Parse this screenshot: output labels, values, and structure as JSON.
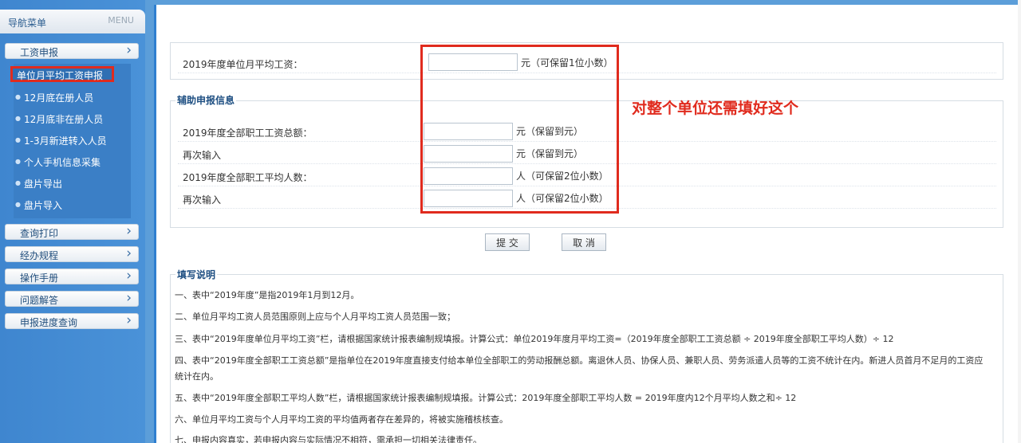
{
  "nav": {
    "title": "导航菜单",
    "menu_label": "MENU",
    "sections": [
      {
        "label": "工资申报"
      },
      {
        "label": "查询打印"
      },
      {
        "label": "经办规程"
      },
      {
        "label": "操作手册"
      },
      {
        "label": "问题解答"
      },
      {
        "label": "申报进度查询"
      }
    ],
    "sub_items": [
      {
        "label": "单位月平均工资申报"
      },
      {
        "label": "12月底在册人员"
      },
      {
        "label": "12月底非在册人员"
      },
      {
        "label": "1-3月新进转入人员"
      },
      {
        "label": "个人手机信息采集"
      },
      {
        "label": "盘片导出"
      },
      {
        "label": "盘片导入"
      }
    ]
  },
  "form": {
    "avg_wage_label": "2019年度单位月平均工资：",
    "avg_wage_value": "",
    "avg_wage_unit": "元（可保留1位小数）",
    "aux_title": "辅助申报信息",
    "aux_rows": [
      {
        "label": "2019年度全部职工工资总额：",
        "value": "",
        "unit": "元（保留到元）"
      },
      {
        "label": "再次输入",
        "value": "",
        "unit": "元（保留到元）"
      },
      {
        "label": "2019年度全部职工平均人数：",
        "value": "",
        "unit": "人（可保留2位小数）"
      },
      {
        "label": "再次输入",
        "value": "",
        "unit": "人（可保留2位小数）"
      }
    ],
    "submit_label": "提 交",
    "cancel_label": "取 消"
  },
  "annotation": "对整个单位还需填好这个",
  "instructions": {
    "title": "填写说明",
    "lines": [
      "一、表中“2019年度”是指2019年1月到12月。",
      "二、单位月平均工资人员范围原则上应与个人月平均工资人员范围一致；",
      "三、表中“2019年度单位月平均工资”栏，请根据国家统计报表编制规填报。计算公式：单位2019年度月平均工资=（2019年度全部职工工资总额 ÷ 2019年度全部职工平均人数）÷ 12",
      "四、表中“2019年度全部职工工资总额”是指单位在2019年度直接支付给本单位全部职工的劳动报酬总额。离退休人员、协保人员、兼职人员、劳务派遣人员等的工资不统计在内。新进人员首月不足月的工资应",
      "统计在内。",
      "五、表中“2019年度全部职工平均人数”栏，请根据国家统计报表编制规填报。计算公式：2019年度全部职工平均人数 = 2019年度内12个月平均人数之和÷ 12",
      "六、单位月平均工资与个人月平均工资的平均值两者存在差异的，将被实施稽核核查。",
      "七、申报内容真实，若申报内容与实际情况不相符，需承担一切相关法律责任。"
    ]
  },
  "colors": {
    "accent_red": "#e02b1e",
    "sidebar_blue": "#3f86cf",
    "heading_blue": "#1e4f82"
  }
}
